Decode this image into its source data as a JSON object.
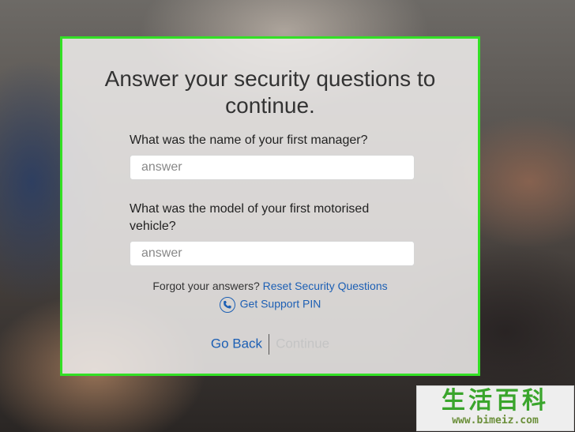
{
  "dialog": {
    "title": "Answer your security questions to continue.",
    "question1": "What was the name of your first manager?",
    "answer1_placeholder": "answer",
    "question2": "What was the model of your first motorised vehicle?",
    "answer2_placeholder": "answer",
    "forgot_text": "Forgot your answers?",
    "reset_link": "Reset Security Questions",
    "support_pin_link": "Get Support PIN",
    "support_pin_icon": "phone-icon",
    "go_back_label": "Go Back",
    "continue_label": "Continue"
  },
  "watermark": {
    "chinese": "生活百科",
    "url": "www.bimeiz.com"
  },
  "colors": {
    "highlight_border": "#33e025",
    "link": "#1c5fb4",
    "disabled": "#c4c4c4"
  }
}
